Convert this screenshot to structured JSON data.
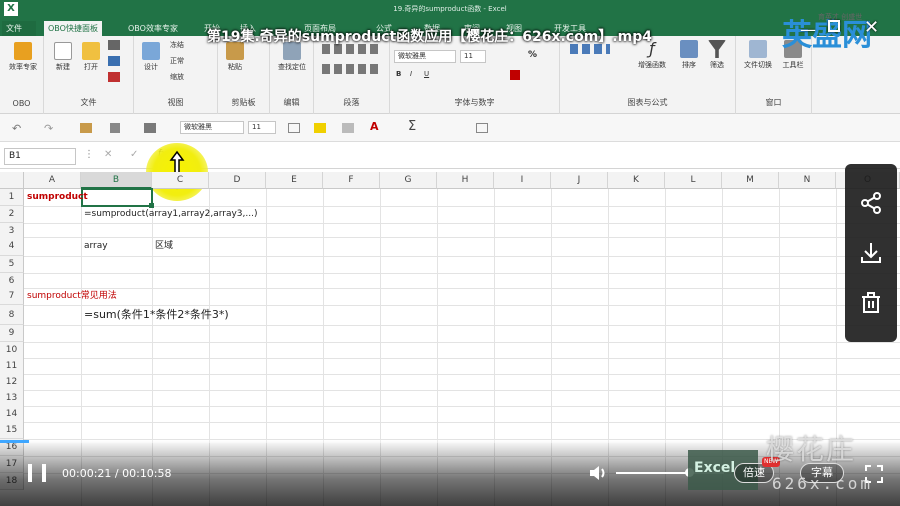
{
  "excel": {
    "app_badge": "X",
    "doc_title": "19.奇异的sumproduct函数 - Excel",
    "tabs": [
      {
        "label": "文件",
        "active": false
      },
      {
        "label": "OBO快捷面板",
        "active": true
      },
      {
        "label": "OBO效率专家",
        "active": false
      },
      {
        "label": "开始",
        "active": false
      },
      {
        "label": "插入",
        "active": false
      },
      {
        "label": "页面布局",
        "active": false
      },
      {
        "label": "公式",
        "active": false
      },
      {
        "label": "数据",
        "active": false
      },
      {
        "label": "审阅",
        "active": false
      },
      {
        "label": "视图",
        "active": false
      },
      {
        "label": "开发工具",
        "active": false
      }
    ],
    "ribbon": {
      "groups": [
        {
          "label": "OBO"
        },
        {
          "label": "文件"
        },
        {
          "label": "视图"
        },
        {
          "label": "剪贴板"
        },
        {
          "label": "编辑"
        },
        {
          "label": "段落"
        },
        {
          "label": "字体与数字"
        },
        {
          "label": "图表与公式"
        },
        {
          "label": "窗口"
        }
      ],
      "buttons": {
        "efficiency": "效率专家",
        "new": "新建",
        "open": "打开",
        "design": "设计",
        "freeze": "冻结",
        "normal": "正常",
        "zoom": "缩放",
        "paste": "粘贴",
        "find": "查找定位",
        "enhanced_func": "增强函数",
        "sort": "排序",
        "filter": "筛选",
        "file_switch": "文件切换",
        "toolbar": "工具栏"
      },
      "font_name": "微软雅黑",
      "font_size": "11"
    },
    "quick_access": {
      "font_name": "微软雅黑",
      "font_size": "11"
    },
    "formula_bar": {
      "name_box": "B1",
      "fx_label": "fx",
      "content": ""
    },
    "columns": [
      "A",
      "B",
      "C",
      "D",
      "E",
      "F",
      "G",
      "H",
      "I",
      "J",
      "K",
      "L",
      "M",
      "N",
      "O"
    ],
    "selected_column": "B",
    "rows": [
      "1",
      "2",
      "3",
      "4",
      "5",
      "6",
      "7",
      "8",
      "9",
      "10",
      "11",
      "12",
      "13",
      "14",
      "15",
      "16",
      "17",
      "18"
    ],
    "cells": {
      "A1": "sumproduct",
      "B2": "=sumproduct(array1,array2,array3,...)",
      "B4": "array",
      "C4": "区域",
      "A7": "sumproduct常见用法",
      "B8": "=sum(条件1*条件2*条件3*)"
    },
    "colors": {
      "excel_green": "#217346",
      "accent_red": "#c00000",
      "cursor_highlight": "#f5f000"
    }
  },
  "video_player": {
    "title": "第19集.奇异的sumproduct函数应用【樱花庄：626x.com】.mp4",
    "current_time": "00:00:21",
    "separator": " / ",
    "duration": "00:10:58",
    "progress_fraction": 0.032,
    "volume_fraction": 0.68,
    "speed_label": "倍速",
    "new_badge": "NEW",
    "subtitle_label": "字幕",
    "side_panel_icons": [
      "share-icon",
      "download-icon",
      "delete-icon"
    ],
    "watermark_main": "樱花庄",
    "watermark_sub": "626x.com",
    "brand_logo": "英盛网",
    "brand_slogan": "育英才 创盛世",
    "excel_logo": "Excel"
  }
}
